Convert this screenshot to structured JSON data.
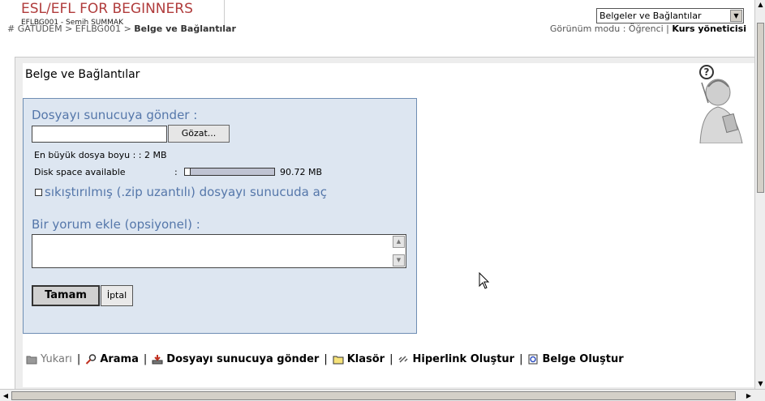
{
  "site": {
    "title": "ESL/EFL FOR BEGINNERS",
    "user_line": "EFLBG001 - Semih SUMMAK"
  },
  "breadcrumb": {
    "hash": "#",
    "path": " GATÜDEM > EFLBG001 > ",
    "current": "Belge ve Bağlantılar"
  },
  "view_mode": {
    "label": "Görünüm modu : Öğrenci | ",
    "active": "Kurs yöneticisi"
  },
  "nav_select": {
    "selected": "Belgeler ve Bağlantılar"
  },
  "page": {
    "heading": "Belge ve Bağlantılar"
  },
  "upload_form": {
    "send_label": "Dosyayı sunucuya gönder :",
    "file_value": "",
    "browse_label": "Gözat...",
    "max_size_label": "En büyük dosya boyu : : 2 MB",
    "disk_label": "Disk space available",
    "disk_colon": ":",
    "disk_value": "90.72 MB",
    "disk_used_fraction": 0.06,
    "unzip_label": "sıkıştırılmış (.zip uzantılı) dosyayı sunucuda aç",
    "unzip_checked": false,
    "comment_label": "Bir yorum ekle (opsiyonel) :",
    "comment_value": "",
    "ok_label": "Tamam",
    "cancel_label": "İptal"
  },
  "toolbar": {
    "items": [
      {
        "label": "Yukarı",
        "icon": "folder-up-icon",
        "enabled": false
      },
      {
        "label": "Arama",
        "icon": "search-icon",
        "enabled": true
      },
      {
        "label": "Dosyayı sunucuya gönder",
        "icon": "upload-icon",
        "enabled": true
      },
      {
        "label": "Klasör",
        "icon": "folder-icon",
        "enabled": true
      },
      {
        "label": "Hiperlink Oluştur",
        "icon": "link-icon",
        "enabled": true
      },
      {
        "label": "Belge Oluştur",
        "icon": "document-icon",
        "enabled": true
      }
    ],
    "separator": "|"
  },
  "colors": {
    "title": "#b03c3c",
    "form_bg": "#dde6f1",
    "form_border": "#6f8eb4",
    "label_blue": "#5577aa"
  }
}
